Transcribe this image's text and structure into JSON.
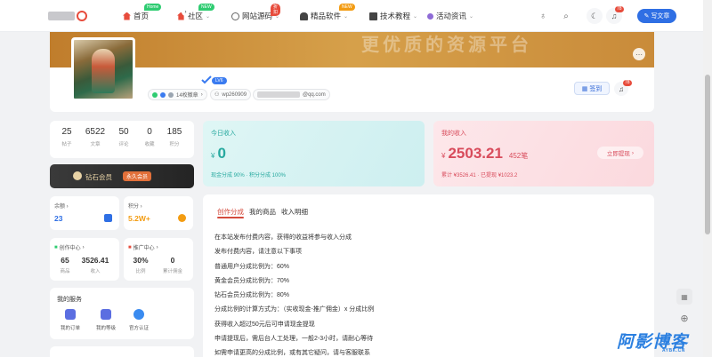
{
  "nav": {
    "items": [
      {
        "label": "首页",
        "tag": "Home",
        "tag_color": "#2ecc71"
      },
      {
        "label": "社区",
        "tag": "NEW",
        "tag_color": "#2ecc71"
      },
      {
        "label": "网站源码",
        "tag": "折扣",
        "tag_color": "#e74c3c"
      },
      {
        "label": "精品软件",
        "tag": "NEW",
        "tag_color": "#f39c12"
      },
      {
        "label": "技术教程",
        "tag": "",
        "tag_color": ""
      },
      {
        "label": "活动资讯",
        "tag": "",
        "tag_color": ""
      }
    ],
    "notif_count": "78",
    "write_label": "写文章"
  },
  "profile": {
    "banner_text": "更优质的资源平台",
    "level": "LV6",
    "likes": "14枚徽章",
    "user_id": "wp260909",
    "email_suffix": "@qq.com",
    "sign_label": "签到",
    "notif_count": "78"
  },
  "stats": [
    {
      "value": "25",
      "label": "帖子"
    },
    {
      "value": "6522",
      "label": "文章"
    },
    {
      "value": "50",
      "label": "评论"
    },
    {
      "value": "0",
      "label": "收藏"
    },
    {
      "value": "185",
      "label": "积分"
    }
  ],
  "vip": {
    "label": "钻石会员",
    "tag": "永久会员"
  },
  "balance": {
    "title": "余额",
    "value": "23",
    "color": "#2f6fe4"
  },
  "points": {
    "title": "积分",
    "value": "5.2W+",
    "color": "#f39c12"
  },
  "creator": {
    "title": "创作中心",
    "cols": [
      {
        "value": "65",
        "label": "商品"
      },
      {
        "value": "3526.41",
        "label": "收入"
      }
    ]
  },
  "promo": {
    "title": "推广中心",
    "cols": [
      {
        "value": "30%",
        "label": "比例"
      },
      {
        "value": "0",
        "label": "累计佣金"
      }
    ]
  },
  "services": {
    "title": "我的服务",
    "items": [
      {
        "label": "我的订单",
        "color": "#5b6ee1"
      },
      {
        "label": "我的等级",
        "color": "#5b6ee1"
      },
      {
        "label": "官方认证",
        "color": "#3a8bf0"
      }
    ]
  },
  "income_today": {
    "title": "今日收入",
    "currency": "¥",
    "amount": "0",
    "sub": "现金分成 90% · 积分分成 100%"
  },
  "income_mine": {
    "title": "我的收入",
    "currency": "¥",
    "amount": "2503.21",
    "count": "452笔",
    "sub": "累计 ¥3526.41 · 已提现 ¥1023.2",
    "withdraw_label": "立即提现"
  },
  "main": {
    "tabs": [
      "创作分成",
      "我的商品",
      "收入明细"
    ],
    "rules": [
      "在本站发布付费内容，获得的收益将参与收入分成",
      "发布付费内容，请注意以下事项",
      "普通用户分成比例为：60%",
      "黄金会员分成比例为：70%",
      "钻石会员分成比例为：80%",
      "分成比例的计算方式为：（实收现金-推广佣金）x 分成比例",
      "获得收入超过50元后可申请现金提现",
      "申请提现后，需后台人工处理，一般2-3小时，请耐心等待",
      "如需申请更高的分成比例，或有其它疑问，请与客服联系"
    ]
  },
  "watermark": {
    "main": "阿影博客",
    "sub": "AYBK.CN"
  }
}
